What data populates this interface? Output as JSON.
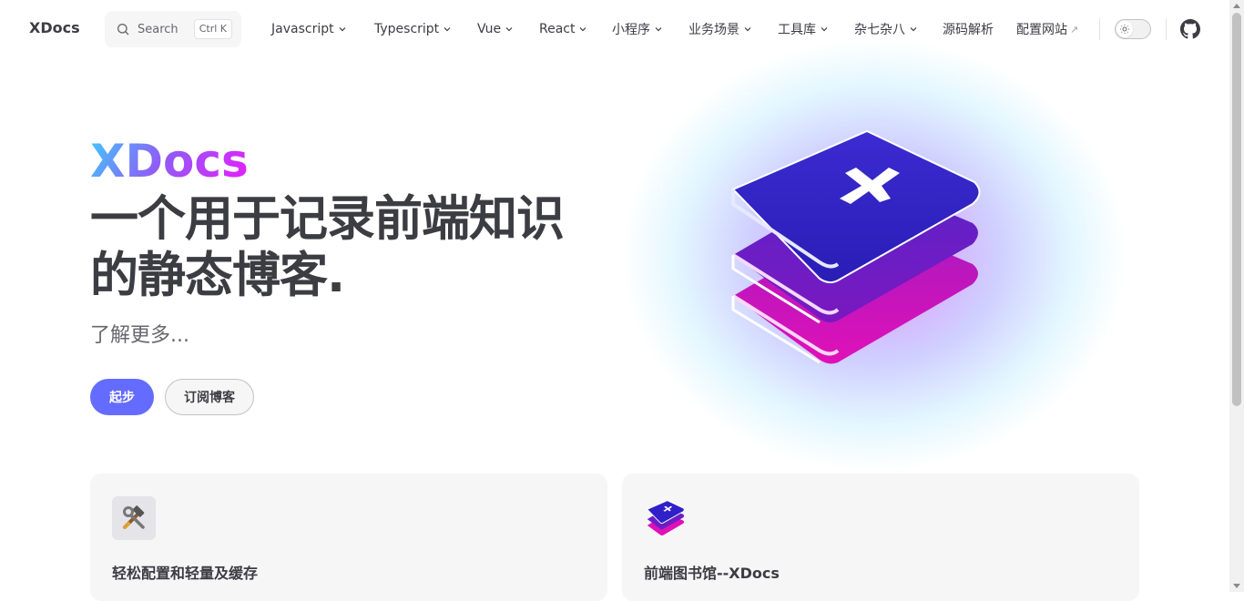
{
  "site": {
    "logo": "XDocs"
  },
  "search": {
    "placeholder": "Search",
    "shortcut": "Ctrl K"
  },
  "nav": {
    "items": [
      {
        "label": "Javascript",
        "dropdown": true
      },
      {
        "label": "Typescript",
        "dropdown": true
      },
      {
        "label": "Vue",
        "dropdown": true
      },
      {
        "label": "React",
        "dropdown": true
      },
      {
        "label": "小程序",
        "dropdown": true
      },
      {
        "label": "业务场景",
        "dropdown": true
      },
      {
        "label": "工具库",
        "dropdown": true
      },
      {
        "label": "杂七杂八",
        "dropdown": true
      },
      {
        "label": "源码解析",
        "dropdown": false
      },
      {
        "label": "配置网站",
        "dropdown": false,
        "external": true
      }
    ],
    "external_icon": "↗"
  },
  "hero": {
    "name": "XDocs",
    "text_line1": "一个用于记录前端知识",
    "text_line2": "的静态博客.",
    "tagline": "了解更多...",
    "actions": {
      "primary": "起步",
      "secondary": "订阅博客"
    }
  },
  "features": [
    {
      "icon": "hammer-wrench-icon",
      "title": "轻松配置和轻量及缓存"
    },
    {
      "icon": "book-stack-icon",
      "title": "前端图书馆--XDocs"
    }
  ],
  "colors": {
    "brand": "#646cff",
    "gradient_start": "#40c9ff",
    "gradient_end": "#e81cff"
  }
}
